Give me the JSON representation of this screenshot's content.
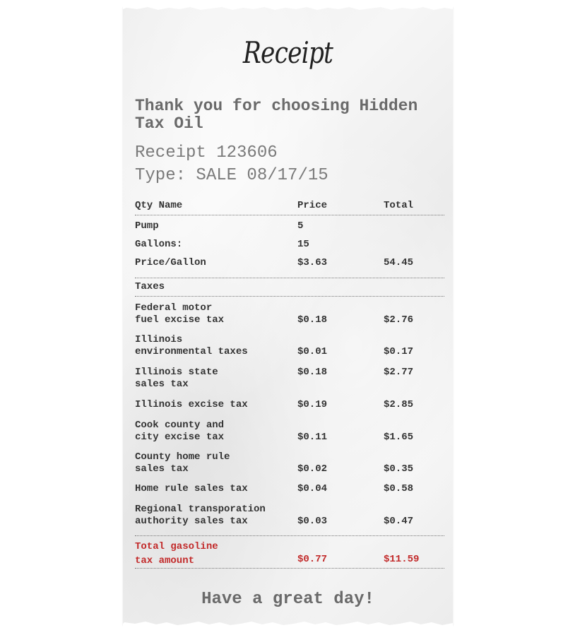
{
  "logo": "Receipt",
  "thanks": "Thank you for choosing Hidden Tax Oil",
  "receipt_number": "Receipt 123606",
  "receipt_type": "Type: SALE 08/17/15",
  "columns": {
    "qty_name": "Qty Name",
    "price": "Price",
    "total": "Total"
  },
  "items": [
    {
      "name": "Pump",
      "price": "5",
      "total": ""
    },
    {
      "name": "Gallons:",
      "price": "15",
      "total": ""
    },
    {
      "name": "Price/Gallon",
      "price": "$3.63",
      "total": "54.45"
    }
  ],
  "taxes_heading": "Taxes",
  "taxes": [
    {
      "name": "Federal motor\nfuel excise tax",
      "price": "$0.18",
      "total": "$2.76"
    },
    {
      "name": "Illinois\nenvironmental taxes",
      "price": "$0.01",
      "total": "$0.17"
    },
    {
      "name": "Illinois state\nsales tax",
      "price": "$0.18",
      "total": "$2.77"
    },
    {
      "name": "Illinois excise tax",
      "price": "$0.19",
      "total": "$2.85"
    },
    {
      "name": "Cook county and\ncity excise tax",
      "price": "$0.11",
      "total": "$1.65"
    },
    {
      "name": "County home rule\nsales tax",
      "price": "$0.02",
      "total": "$0.35"
    },
    {
      "name": "Home rule sales tax",
      "price": "$0.04",
      "total": "$0.58"
    },
    {
      "name": "Regional transporation\nauthority sales tax",
      "price": "$0.03",
      "total": "$0.47"
    }
  ],
  "total": {
    "name": "Total gasoline\ntax amount",
    "price": "$0.77",
    "total": "$11.59"
  },
  "farewell": "Have a great day!",
  "colors": {
    "paper": "#f0f0f0",
    "text": "#333333",
    "heading_gray": "#6a6a6a",
    "total_red": "#c22a2a"
  }
}
